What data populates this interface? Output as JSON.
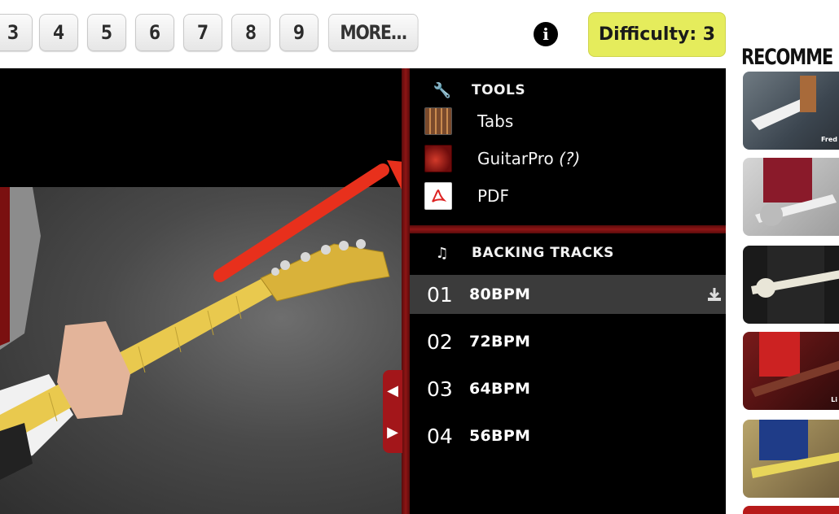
{
  "pagination": {
    "pages": [
      "3",
      "4",
      "5",
      "6",
      "7",
      "8",
      "9"
    ],
    "more_label": "MORE..."
  },
  "difficulty_label": "Difficulty: 3",
  "tools": {
    "heading": "TOOLS",
    "items": [
      {
        "label": "Tabs",
        "suffix": ""
      },
      {
        "label": "GuitarPro",
        "suffix": "(?)"
      },
      {
        "label": "PDF",
        "suffix": ""
      }
    ]
  },
  "backing_tracks": {
    "heading": "BACKING TRACKS",
    "items": [
      {
        "number": "01",
        "bpm": "80BPM"
      },
      {
        "number": "02",
        "bpm": "72BPM"
      },
      {
        "number": "03",
        "bpm": "64BPM"
      },
      {
        "number": "04",
        "bpm": "56BPM"
      }
    ]
  },
  "recommended": {
    "heading": "RECOMME",
    "captions": [
      "Fred",
      "",
      "",
      "Li",
      "",
      ""
    ]
  },
  "colors": {
    "accent_red": "#8e1515",
    "difficulty_bg": "#e5ec5c",
    "arrow": "#e8301c"
  },
  "icons": [
    "info-icon",
    "wrench-icon",
    "music-note-icon",
    "download-icon",
    "pdf-icon"
  ]
}
